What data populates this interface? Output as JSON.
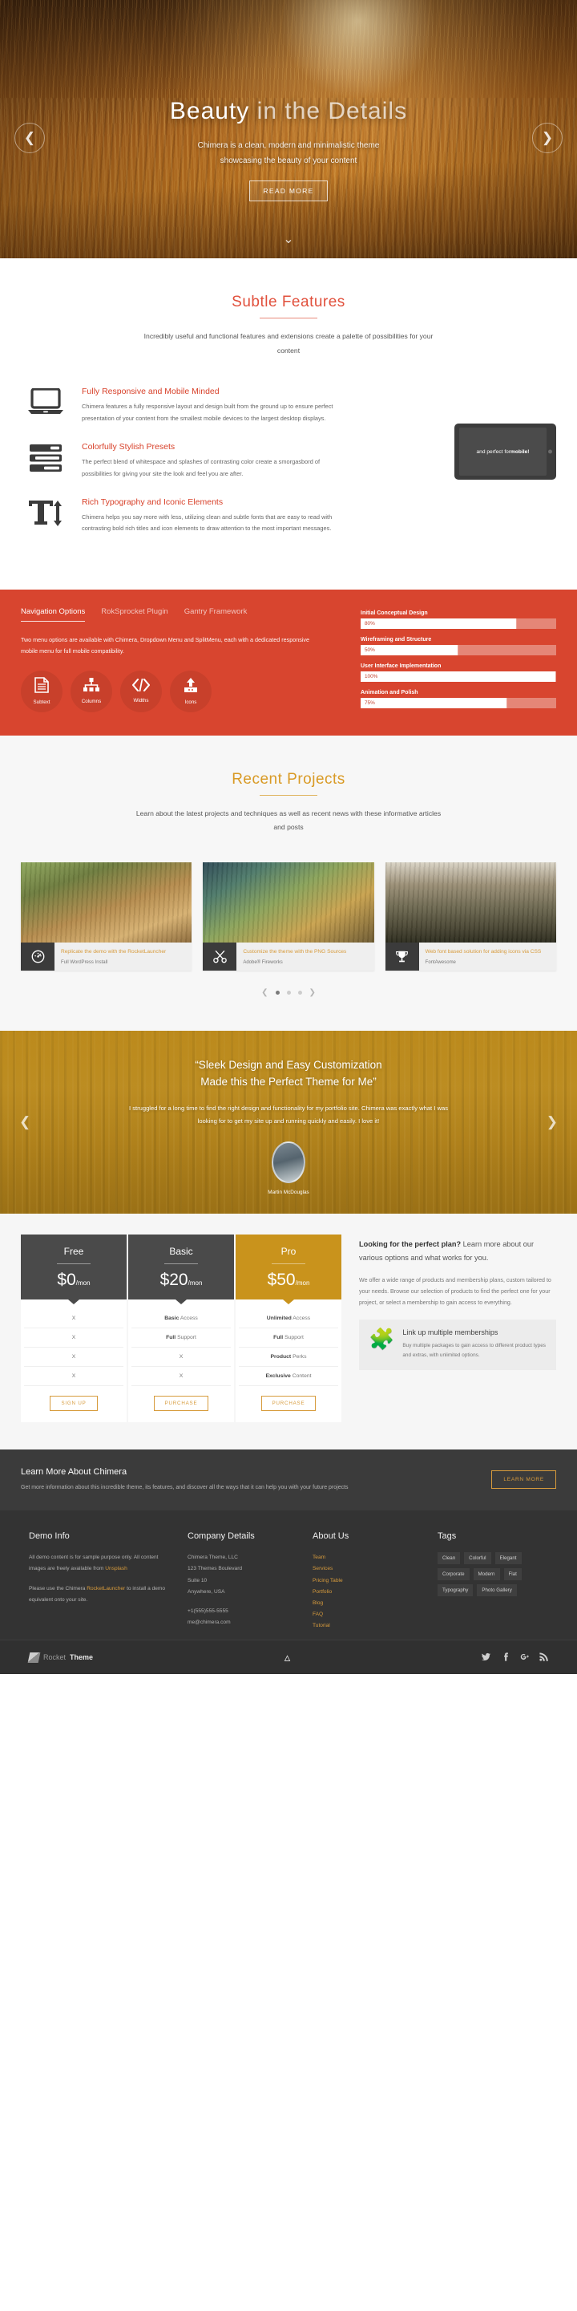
{
  "hero": {
    "title_strong": "Beauty",
    "title_light": " in the Details",
    "subtitle_line1": "Chimera is a clean, modern and minimalistic theme",
    "subtitle_line2": "showcasing the beauty of your content",
    "button": "READ MORE",
    "prev_icon": "chevron-left-icon",
    "next_icon": "chevron-right-icon",
    "scroll_icon": "chevron-down-icon"
  },
  "features": {
    "title": "Subtle Features",
    "desc": "Incredibly useful and functional features and extensions create a palette of possibilities for your content",
    "items": [
      {
        "heading": "Fully Responsive and Mobile Minded",
        "body": "Chimera features a fully responsive layout and design built from the ground up to ensure perfect presentation of your content from the smallest mobile devices to the largest desktop displays.",
        "icon": "laptop-icon"
      },
      {
        "heading": "Colorfully Stylish Presets",
        "body": "The perfect blend of whitespace and splashes of contrasting color create a smorgasbord of possibilities for giving your site the look and feel you are after.",
        "icon": "presets-bars-icon"
      },
      {
        "heading": "Rich Typography and Iconic Elements",
        "body": "Chimera helps you say more with less, utilizing clean and subtle fonts that are easy to read with contrasting bold rich titles and icon elements to draw attention to the most important messages.",
        "icon": "typography-icon"
      }
    ],
    "device_text_plain": "and perfect for ",
    "device_text_bold": "mobile!"
  },
  "redpanel": {
    "tabs": [
      {
        "label": "Navigation Options",
        "active": true
      },
      {
        "label": "RokSprocket Plugin",
        "active": false
      },
      {
        "label": "Gantry Framework",
        "active": false
      }
    ],
    "body": "Two menu options are available with Chimera, Dropdown Menu and SplitMenu, each with a dedicated responsive mobile menu for full mobile compatibility.",
    "icons": [
      {
        "label": "Subtext",
        "icon": "document-lines-icon"
      },
      {
        "label": "Columns",
        "icon": "sitemap-icon"
      },
      {
        "label": "Widths",
        "icon": "code-icon"
      },
      {
        "label": "Icons",
        "icon": "upload-icon"
      }
    ],
    "progress": [
      {
        "label": "Initial Conceptual Design",
        "value": "80%",
        "pct": 80
      },
      {
        "label": "Wireframing and Structure",
        "value": "50%",
        "pct": 50
      },
      {
        "label": "User Interface Implementation",
        "value": "100%",
        "pct": 100
      },
      {
        "label": "Animation and Polish",
        "value": "75%",
        "pct": 75
      }
    ]
  },
  "projects": {
    "title": "Recent Projects",
    "desc": "Learn about the latest projects and techniques as well as recent news with these informative articles and posts",
    "cards": [
      {
        "title": "Replicate the demo with the RocketLauncher",
        "sub": "Full WordPress Install",
        "icon": "gauge-icon"
      },
      {
        "title": "Customize the theme with the PNG Sources",
        "sub": "Adobe® Fireworks",
        "icon": "scissors-icon"
      },
      {
        "title": "Web font based solution for adding icons via CSS",
        "sub": "FontAwesome",
        "icon": "trophy-icon"
      }
    ],
    "prev_icon": "chevron-left-icon",
    "next_icon": "chevron-right-icon",
    "dots": [
      false,
      true,
      false,
      false
    ]
  },
  "testimonial": {
    "quote_line1": "“Sleek Design and Easy Customization",
    "quote_line2": "Made this the Perfect Theme for Me”",
    "body": "I struggled for a long time to find the right design and functionality for my portfolio site. Chimera was exactly what I was looking for to get my site up and running quickly and easily. I love it!",
    "author": "Martin McDouglas",
    "prev_icon": "chevron-left-icon",
    "next_icon": "chevron-right-icon"
  },
  "pricing": {
    "plans": [
      {
        "name": "Free",
        "price": "$0",
        "per": "/mon",
        "style": "dark",
        "features": [
          {
            "bold": "",
            "rest": "X"
          },
          {
            "bold": "",
            "rest": "X"
          },
          {
            "bold": "",
            "rest": "X"
          },
          {
            "bold": "",
            "rest": "X"
          }
        ],
        "button": "SIGN UP"
      },
      {
        "name": "Basic",
        "price": "$20",
        "per": "/mon",
        "style": "dark",
        "features": [
          {
            "bold": "Basic",
            "rest": " Access"
          },
          {
            "bold": "Full",
            "rest": " Support"
          },
          {
            "bold": "",
            "rest": "X"
          },
          {
            "bold": "",
            "rest": "X"
          }
        ],
        "button": "PURCHASE"
      },
      {
        "name": "Pro",
        "price": "$50",
        "per": "/mon",
        "style": "gold",
        "features": [
          {
            "bold": "Unlimited",
            "rest": " Access"
          },
          {
            "bold": "Full",
            "rest": " Support"
          },
          {
            "bold": "Product",
            "rest": " Perks"
          },
          {
            "bold": "Exclusive",
            "rest": " Content"
          }
        ],
        "button": "PURCHASE"
      }
    ],
    "side_heading_bold": "Looking for the perfect plan?",
    "side_heading_rest": " Learn more about our various options and what works for you.",
    "side_body": "We offer a wide range of products and membership plans, custom tailored to your needs. Browse our selection of products to find the perfect one for your project, or select a membership to gain access to everything.",
    "box_title": "Link up multiple memberships",
    "box_body": "Buy multiple packages to gain access to different product types and extras, with unlimited options.",
    "box_icon": "puzzle-icon"
  },
  "cta": {
    "title": "Learn More About Chimera",
    "body": "Get more information about this incredible theme, its features, and discover all the ways that it can help you with your future projects",
    "button": "LEARN MORE"
  },
  "footer": {
    "columns": {
      "demo": {
        "heading": "Demo Info",
        "p1_a": "All demo content is for sample purpose only. All content images are freely available from ",
        "p1_link": "Unsplash",
        "p2_a": "Please use the Chimera ",
        "p2_link": "RocketLauncher",
        "p2_b": " to install a demo equivalent onto your site."
      },
      "company": {
        "heading": "Company Details",
        "lines": [
          "Chimera Theme, LLC",
          "123 Themes Boulevard",
          "Suite 10",
          "Anywhere, USA"
        ],
        "phone": "+1(555)555-5555",
        "email": "me@chimera.com"
      },
      "about": {
        "heading": "About Us",
        "links": [
          "Team",
          "Services",
          "Pricing Table",
          "Portfolio",
          "Blog",
          "FAQ",
          "Tutorial"
        ]
      },
      "tags": {
        "heading": "Tags",
        "items": [
          "Clean",
          "Colorful",
          "Elegant",
          "Corporate",
          "Modern",
          "Flat",
          "Typography",
          "Photo Gallery"
        ]
      }
    },
    "brand_a": "Rocket",
    "brand_b": "Theme",
    "top_icon": "chevron-up-icon",
    "socials": [
      "twitter-icon",
      "facebook-icon",
      "google-plus-icon",
      "rss-icon"
    ]
  },
  "colors": {
    "red": "#d8452f",
    "gold": "#d79b3c",
    "dark": "#3b3b3b",
    "heading_red": "#e1503c"
  }
}
